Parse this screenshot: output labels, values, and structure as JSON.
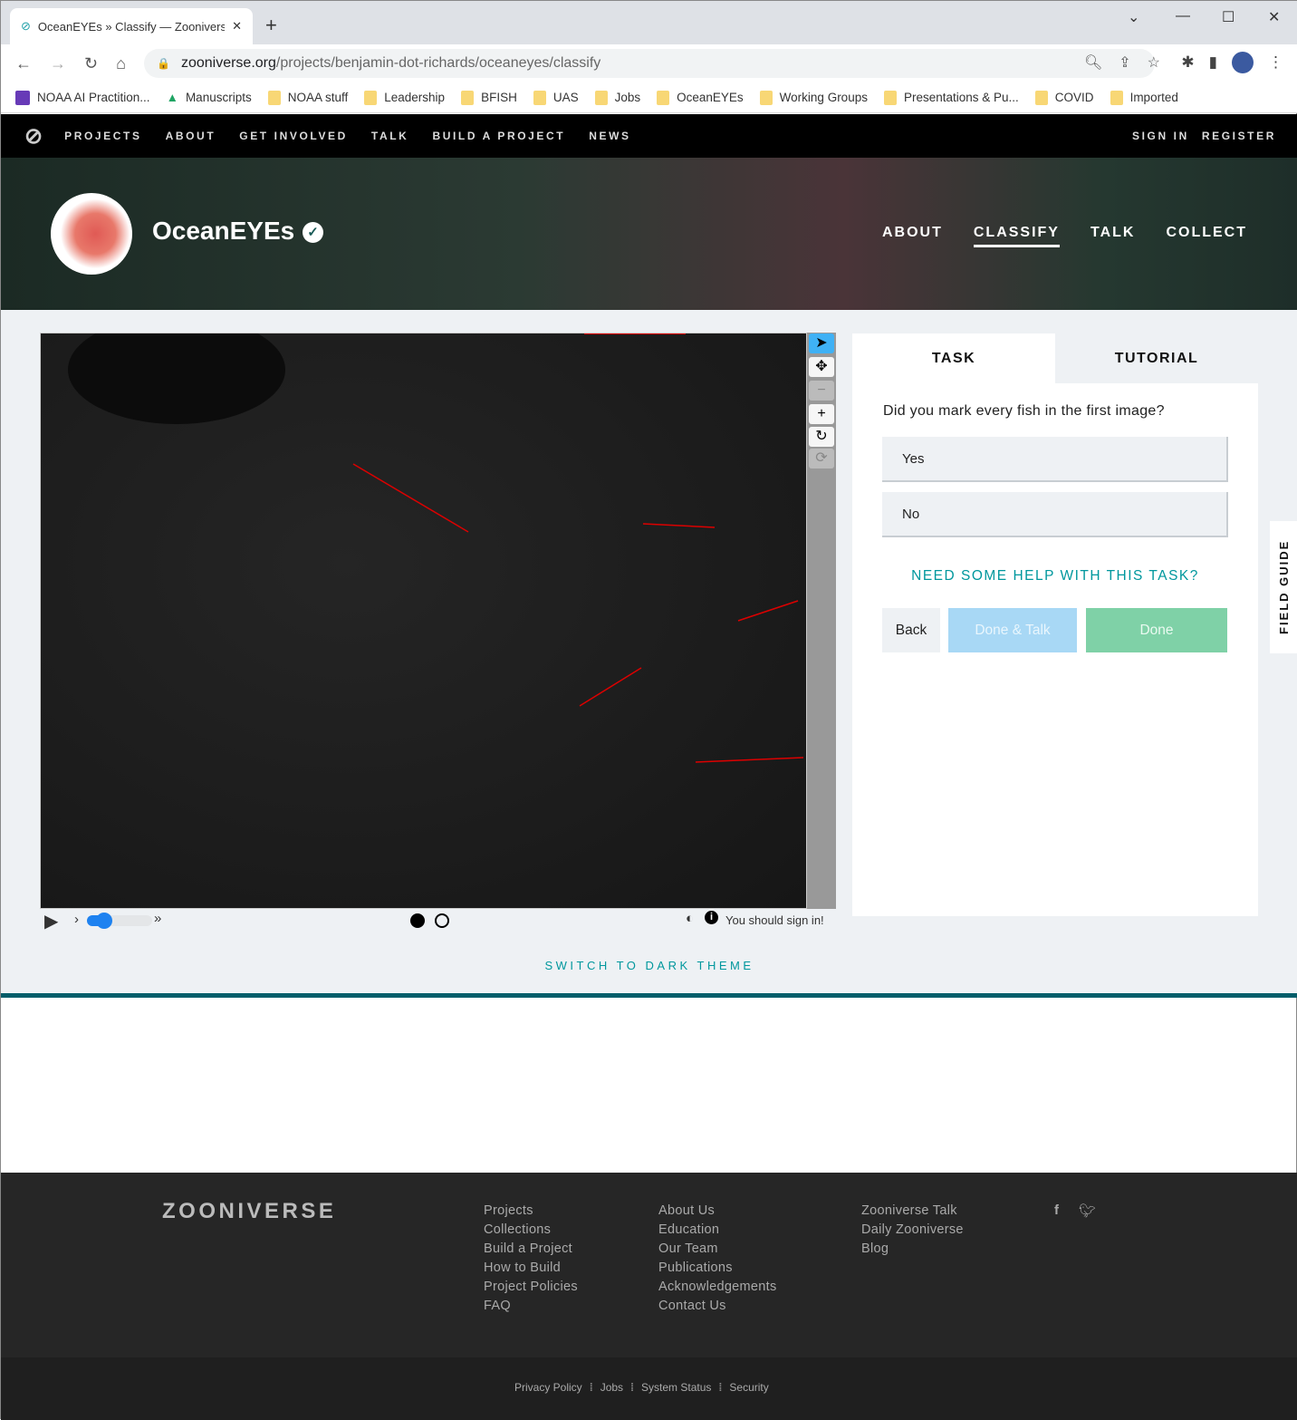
{
  "browser": {
    "tab_title": "OceanEYEs » Classify — Zooniverse",
    "url_host": "zooniverse.org",
    "url_path": "/projects/benjamin-dot-richards/oceaneyes/classify",
    "bookmarks": [
      "NOAA AI Practition...",
      "Manuscripts",
      "NOAA stuff",
      "Leadership",
      "BFISH",
      "UAS",
      "Jobs",
      "OceanEYEs",
      "Working Groups",
      "Presentations & Pu...",
      "COVID",
      "Imported"
    ]
  },
  "site_nav": {
    "items": [
      "PROJECTS",
      "ABOUT",
      "GET INVOLVED",
      "TALK",
      "BUILD A PROJECT",
      "NEWS"
    ],
    "sign_in": "SIGN IN",
    "register": "REGISTER"
  },
  "project": {
    "title": "OceanEYEs",
    "nav": [
      "ABOUT",
      "CLASSIFY",
      "TALK",
      "COLLECT"
    ],
    "active_nav": "CLASSIFY"
  },
  "viewer": {
    "sign_in_msg": "You should sign in!",
    "frames": 2,
    "current_frame": 1
  },
  "task": {
    "tabs": [
      "TASK",
      "TUTORIAL"
    ],
    "question": "Did you mark every fish in the first image?",
    "answers": [
      "Yes",
      "No"
    ],
    "help": "NEED SOME HELP WITH THIS TASK?",
    "back": "Back",
    "done_talk": "Done & Talk",
    "done": "Done",
    "field_guide": "FIELD GUIDE"
  },
  "switch_theme": "SWITCH TO DARK THEME",
  "footer": {
    "logo": "ZOONIVERSE",
    "col1": [
      "Projects",
      "Collections",
      "Build a Project",
      "How to Build",
      "Project Policies",
      "FAQ"
    ],
    "col2": [
      "About Us",
      "Education",
      "Our Team",
      "Publications",
      "Acknowledgements",
      "Contact Us"
    ],
    "col3": [
      "Zooniverse Talk",
      "Daily Zooniverse",
      "Blog"
    ],
    "legal": [
      "Privacy Policy",
      "Jobs",
      "System Status",
      "Security"
    ]
  },
  "colors": {
    "accent": "#00979d",
    "done": "#7fd1a7",
    "done_talk": "#a8d8f5",
    "teal_rule": "#005d69"
  }
}
